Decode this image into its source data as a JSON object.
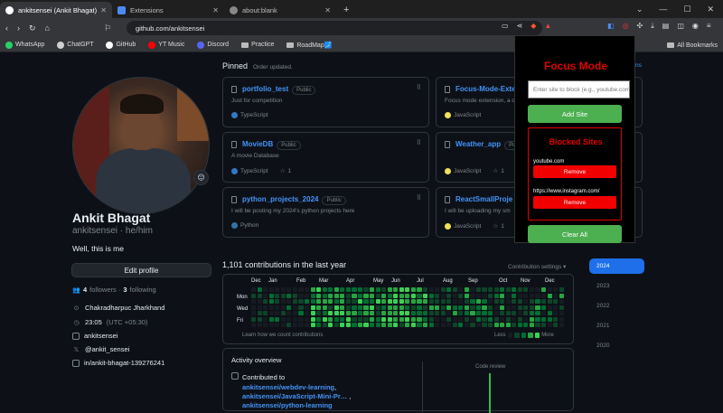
{
  "browser": {
    "tabs": [
      {
        "label": "ankitsensei (Ankit Bhagat)",
        "icon": "github-icon",
        "active": true
      },
      {
        "label": "Extensions",
        "icon": "puzzle-icon",
        "active": false
      },
      {
        "label": "about:blank",
        "icon": "globe-icon",
        "active": false
      }
    ],
    "new_tab": "+",
    "url": "github.com/ankitsensei",
    "bookmarks": [
      {
        "label": "WhatsApp",
        "color": "#25d366"
      },
      {
        "label": "ChatGPT",
        "color": "#cfcfcf"
      },
      {
        "label": "GitHub",
        "color": "#ffffff"
      },
      {
        "label": "YT Music",
        "color": "#ff0000"
      },
      {
        "label": "Discord",
        "color": "#5865f2"
      },
      {
        "label": "Practice",
        "color": "#bbbbbb"
      },
      {
        "label": "RoadMap🗾",
        "color": "#bbbbbb"
      }
    ],
    "all_bookmarks": "All Bookmarks"
  },
  "profile": {
    "name": "Ankit Bhagat",
    "handle": "ankitsensei · he/him",
    "bio": "Well, this is me",
    "edit_button": "Edit profile",
    "followers_count": "4",
    "followers_label": "followers ·",
    "following_count": "3",
    "following_label": "following",
    "location": "Chakradharpuc Jharkhand",
    "time": "23:05",
    "timezone": "(UTC +05:30)",
    "email": "ankitsensei",
    "twitter": "@ankit_sensei",
    "linkedin": "in/ankit-bhagat-139276241",
    "emoji_badge": "😐"
  },
  "pinned": {
    "heading": "Pinned",
    "sub": "Order updated.",
    "customize": "ains",
    "public_label": "Public",
    "cards": [
      {
        "title": "portfolio_test",
        "desc": "Just for competition",
        "lang": "TypeScript",
        "lang_color": "#3178c6",
        "stars": ""
      },
      {
        "title": "Focus-Mode-Exte",
        "desc": "Focus mode extension, a c",
        "lang": "JavaScript",
        "lang_color": "#f1e05a",
        "stars": ""
      },
      {
        "title": "MovieDB",
        "desc": "A movie Database",
        "lang": "TypeScript",
        "lang_color": "#3178c6",
        "stars": "1"
      },
      {
        "title": "Weather_app",
        "desc": "",
        "lang": "JavaScript",
        "lang_color": "#f1e05a",
        "stars": "1"
      },
      {
        "title": "python_projects_2024",
        "desc": "I will be posting my 2024's python projects here",
        "lang": "Python",
        "lang_color": "#3572a5",
        "stars": ""
      },
      {
        "title": "ReactSmallProje",
        "desc": "I will be uploading my sm",
        "lang": "JavaScript",
        "lang_color": "#f1e05a",
        "stars": "1"
      }
    ]
  },
  "contributions": {
    "heading": "1,101 contributions in the last year",
    "settings": "Contribution settings ▾",
    "months": [
      "Dec",
      "Jan",
      "Feb",
      "Mar",
      "Apr",
      "May",
      "Jun",
      "Jul",
      "Aug",
      "Sep",
      "Oct",
      "Nov",
      "Dec"
    ],
    "days": [
      "Mon",
      "Wed",
      "Fri"
    ],
    "learn": "Learn how we count contributions",
    "less": "Less",
    "more": "More",
    "levels": [
      "#161b22",
      "#0e4429",
      "#006d32",
      "#26a641",
      "#39d353"
    ],
    "years": [
      "2024",
      "2023",
      "2022",
      "2021",
      "2020"
    ]
  },
  "activity": {
    "title": "Activity overview",
    "contributed_to": "Contributed to",
    "repo1": "ankitsensei/webdev-learning",
    "repo2": "ankitsensei/JavaScript-Mini-Pr…",
    "repo3": "ankitsensei/python-learning",
    "code_review": "Code review"
  },
  "focus_popup": {
    "title": "Focus Mode",
    "input_placeholder": "Enter site to block (e.g., youtube.com)",
    "add_button": "Add Site",
    "blocked_title": "Blocked Sites",
    "sites": [
      "youtube.com",
      "https://www.instagram.com/"
    ],
    "remove_label": "Remove",
    "clear_button": "Clear All"
  }
}
